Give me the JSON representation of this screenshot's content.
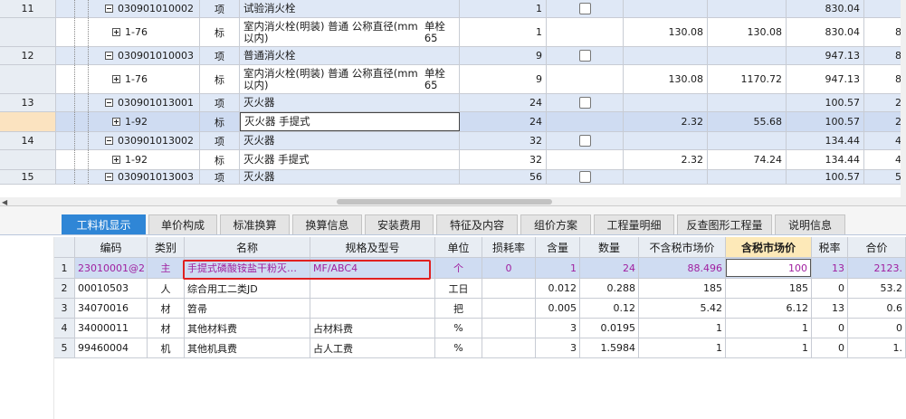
{
  "upper_rows": [
    {
      "num": "11",
      "tree": "minus",
      "code": "030901010002",
      "kind": "项",
      "desc": "试验消火栓",
      "desc2": "",
      "qty": "1",
      "checkbox": true,
      "price": "",
      "total": "",
      "sum": "830.04",
      "extra": ""
    },
    {
      "num": "",
      "tree": "plus",
      "code": "1-76",
      "kind": "标",
      "desc": "室内消火栓(明装) 普通 公称直径(mm以内)",
      "desc2": "单栓65",
      "qty": "1",
      "checkbox": false,
      "price": "130.08",
      "total": "130.08",
      "sum": "830.04",
      "extra": "8"
    },
    {
      "num": "12",
      "tree": "minus",
      "code": "030901010003",
      "kind": "项",
      "desc": "普通消火栓",
      "desc2": "",
      "qty": "9",
      "checkbox": true,
      "price": "",
      "total": "",
      "sum": "947.13",
      "extra": "8"
    },
    {
      "num": "",
      "tree": "plus",
      "code": "1-76",
      "kind": "标",
      "desc": "室内消火栓(明装) 普通 公称直径(mm以内)",
      "desc2": "单栓65",
      "qty": "9",
      "checkbox": false,
      "price": "130.08",
      "total": "1170.72",
      "sum": "947.13",
      "extra": "8"
    },
    {
      "num": "13",
      "tree": "minus",
      "code": "030901013001",
      "kind": "项",
      "desc": "灭火器",
      "desc2": "",
      "qty": "24",
      "checkbox": true,
      "price": "",
      "total": "",
      "sum": "100.57",
      "extra": "2"
    },
    {
      "num": "",
      "tree": "plus",
      "code": "1-92",
      "kind": "标",
      "desc": "灭火器 手提式",
      "desc2": "",
      "qty": "24",
      "checkbox": false,
      "price": "2.32",
      "total": "55.68",
      "sum": "100.57",
      "extra": "2"
    },
    {
      "num": "14",
      "tree": "minus",
      "code": "030901013002",
      "kind": "项",
      "desc": "灭火器",
      "desc2": "",
      "qty": "32",
      "checkbox": true,
      "price": "",
      "total": "",
      "sum": "134.44",
      "extra": "4"
    },
    {
      "num": "",
      "tree": "plus",
      "code": "1-92",
      "kind": "标",
      "desc": "灭火器 手提式",
      "desc2": "",
      "qty": "32",
      "checkbox": false,
      "price": "2.32",
      "total": "74.24",
      "sum": "134.44",
      "extra": "4"
    },
    {
      "num": "15",
      "tree": "minus",
      "code": "030901013003",
      "kind": "项",
      "desc": "灭火器",
      "desc2": "",
      "qty": "56",
      "checkbox": true,
      "price": "",
      "total": "",
      "sum": "100.57",
      "extra": "5"
    }
  ],
  "tabs": [
    "工料机显示",
    "单价构成",
    "标准换算",
    "换算信息",
    "安装费用",
    "特征及内容",
    "组价方案",
    "工程量明细",
    "反查图形工程量",
    "说明信息"
  ],
  "columns": [
    "",
    "编码",
    "类别",
    "名称",
    "规格及型号",
    "单位",
    "损耗率",
    "含量",
    "数量",
    "不含税市场价",
    "含税市场价",
    "税率",
    "合价"
  ],
  "lower_rows": [
    {
      "n": "1",
      "code": "23010001@2",
      "type": "主",
      "name": "手提式磷酸铵盐干粉灭…",
      "spec": "MF/ABC4",
      "unit": "个",
      "loss": "0",
      "content": "1",
      "amount": "24",
      "price_ex": "88.496",
      "price_in": "100",
      "tax": "13",
      "total": "2123."
    },
    {
      "n": "2",
      "code": "00010503",
      "type": "人",
      "name": "综合用工二类JD",
      "spec": "",
      "unit": "工日",
      "loss": "",
      "content": "0.012",
      "amount": "0.288",
      "price_ex": "185",
      "price_in": "185",
      "tax": "0",
      "total": "53.2"
    },
    {
      "n": "3",
      "code": "34070016",
      "type": "材",
      "name": "笤帚",
      "spec": "",
      "unit": "把",
      "loss": "",
      "content": "0.005",
      "amount": "0.12",
      "price_ex": "5.42",
      "price_in": "6.12",
      "tax": "13",
      "total": "0.6"
    },
    {
      "n": "4",
      "code": "34000011",
      "type": "材",
      "name": "其他材料费",
      "spec": "占材料费",
      "unit": "%",
      "loss": "",
      "content": "3",
      "amount": "0.0195",
      "price_ex": "1",
      "price_in": "1",
      "tax": "0",
      "total": "0"
    },
    {
      "n": "5",
      "code": "99460004",
      "type": "机",
      "name": "其他机具费",
      "spec": "占人工费",
      "unit": "%",
      "loss": "",
      "content": "3",
      "amount": "1.5984",
      "price_ex": "1",
      "price_in": "1",
      "tax": "0",
      "total": "1."
    }
  ]
}
